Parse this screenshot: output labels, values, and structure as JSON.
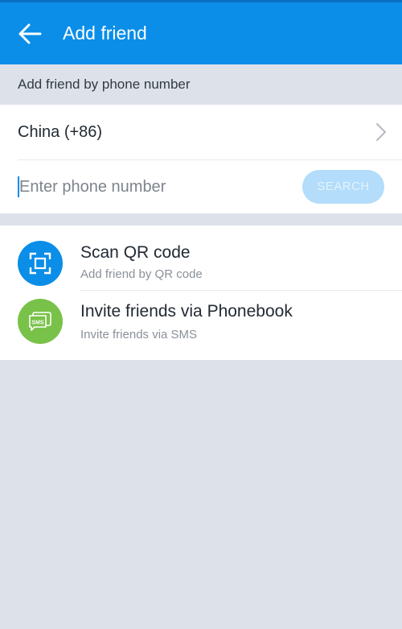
{
  "app_bar": {
    "title": "Add friend",
    "back_icon": "arrow-left-icon",
    "color": "#0a8ee8"
  },
  "phone_section": {
    "header": "Add friend by phone number",
    "country": "China (+86)",
    "chevron_icon": "chevron-right-icon",
    "phone_placeholder": "Enter phone number",
    "phone_value": "",
    "search_label": "SEARCH",
    "search_enabled": false
  },
  "options": [
    {
      "title": "Scan QR code",
      "subtitle": "Add friend by QR code",
      "icon": "qr-scan-icon",
      "icon_color": "#0a8ee8"
    },
    {
      "title": "Invite friends via Phonebook",
      "subtitle": "Invite friends via SMS",
      "icon": "sms-icon",
      "icon_badge": "SMS",
      "icon_color": "#79c249"
    }
  ]
}
